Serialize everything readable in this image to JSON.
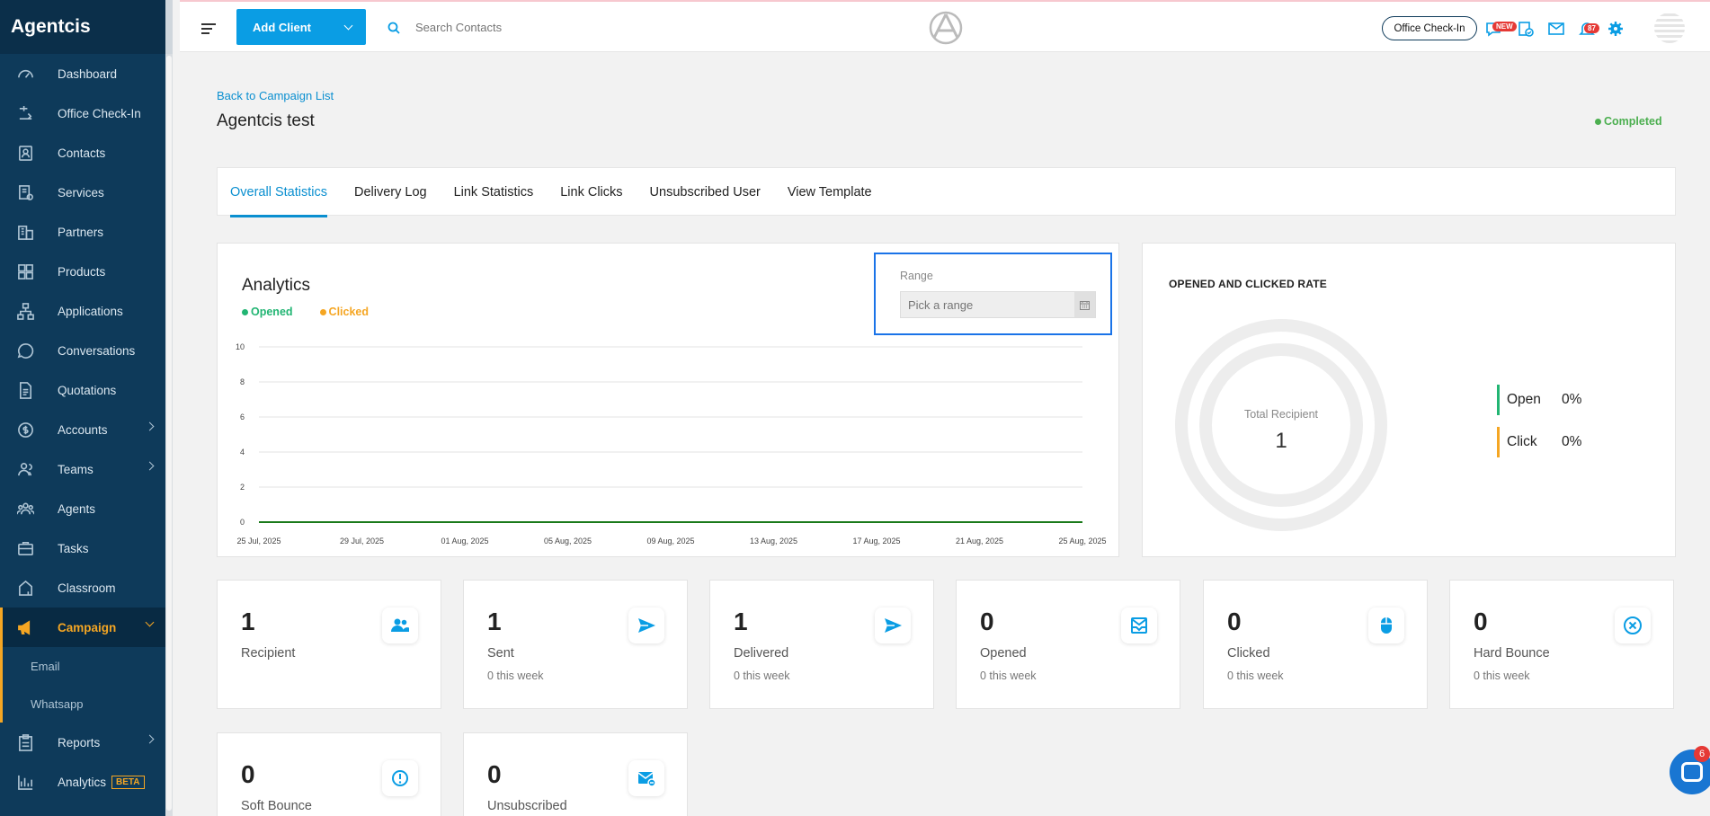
{
  "brand": "Agentcis",
  "sidebar": {
    "items": [
      {
        "label": "Dashboard",
        "icon": "dashboard-icon"
      },
      {
        "label": "Office Check-In",
        "icon": "checkin-icon"
      },
      {
        "label": "Contacts",
        "icon": "contacts-icon"
      },
      {
        "label": "Services",
        "icon": "services-icon"
      },
      {
        "label": "Partners",
        "icon": "partners-icon"
      },
      {
        "label": "Products",
        "icon": "products-icon"
      },
      {
        "label": "Applications",
        "icon": "applications-icon"
      },
      {
        "label": "Conversations",
        "icon": "conversations-icon"
      },
      {
        "label": "Quotations",
        "icon": "quotations-icon"
      },
      {
        "label": "Accounts",
        "icon": "accounts-icon"
      },
      {
        "label": "Teams",
        "icon": "teams-icon"
      },
      {
        "label": "Agents",
        "icon": "agents-icon"
      },
      {
        "label": "Tasks",
        "icon": "tasks-icon"
      },
      {
        "label": "Classroom",
        "icon": "classroom-icon"
      },
      {
        "label": "Campaign",
        "icon": "megaphone-icon"
      },
      {
        "label": "Reports",
        "icon": "reports-icon"
      },
      {
        "label": "Analytics",
        "icon": "analytics-icon"
      }
    ],
    "campaign_sub": [
      "Email",
      "Whatsapp"
    ],
    "beta_label": "BETA"
  },
  "topbar": {
    "add_client_label": "Add Client",
    "search_placeholder": "Search Contacts",
    "office_checkin_label": "Office Check-In",
    "new_badge": "NEW",
    "notification_count": "87"
  },
  "page": {
    "back_link": "Back to Campaign List",
    "title": "Agentcis test",
    "status": "Completed"
  },
  "tabs": [
    "Overall Statistics",
    "Delivery Log",
    "Link Statistics",
    "Link Clicks",
    "Unsubscribed User",
    "View Template"
  ],
  "analytics": {
    "title": "Analytics",
    "legend_opened": "Opened",
    "legend_clicked": "Clicked",
    "range_label": "Range",
    "range_placeholder": "Pick a range"
  },
  "colors": {
    "opened": "#22b573",
    "clicked": "#f5a623",
    "accent": "#0a9de4",
    "sidebar": "#0e3a5a"
  },
  "chart_data": {
    "type": "line",
    "x": [
      "25 Jul, 2025",
      "29 Jul, 2025",
      "01 Aug, 2025",
      "05 Aug, 2025",
      "09 Aug, 2025",
      "13 Aug, 2025",
      "17 Aug, 2025",
      "21 Aug, 2025",
      "25 Aug, 2025"
    ],
    "series": [
      {
        "name": "Opened",
        "values": [
          0,
          0,
          0,
          0,
          0,
          0,
          0,
          0,
          0
        ]
      },
      {
        "name": "Clicked",
        "values": [
          0,
          0,
          0,
          0,
          0,
          0,
          0,
          0,
          0
        ]
      }
    ],
    "yticks": [
      0,
      2,
      4,
      6,
      8,
      10
    ],
    "ylim": [
      0,
      10
    ],
    "grid": true
  },
  "rate": {
    "title": "OPENED AND CLICKED RATE",
    "total_label": "Total Recipient",
    "total_value": "1",
    "open_label": "Open",
    "open_pct": "0%",
    "click_label": "Click",
    "click_pct": "0%"
  },
  "stats": [
    {
      "value": "1",
      "label": "Recipient",
      "sub": "",
      "icon": "users-icon"
    },
    {
      "value": "1",
      "label": "Sent",
      "sub": "0 this week",
      "icon": "send-icon"
    },
    {
      "value": "1",
      "label": "Delivered",
      "sub": "0 this week",
      "icon": "send-icon"
    },
    {
      "value": "0",
      "label": "Opened",
      "sub": "0 this week",
      "icon": "inbox-icon"
    },
    {
      "value": "0",
      "label": "Clicked",
      "sub": "0 this week",
      "icon": "mouse-icon"
    },
    {
      "value": "0",
      "label": "Hard Bounce",
      "sub": "0 this week",
      "icon": "x-circle-icon"
    },
    {
      "value": "0",
      "label": "Soft Bounce",
      "sub": "",
      "icon": "alert-circle-icon"
    },
    {
      "value": "0",
      "label": "Unsubscribed",
      "sub": "",
      "icon": "mail-unsub-icon"
    }
  ],
  "chat_badge": "6"
}
